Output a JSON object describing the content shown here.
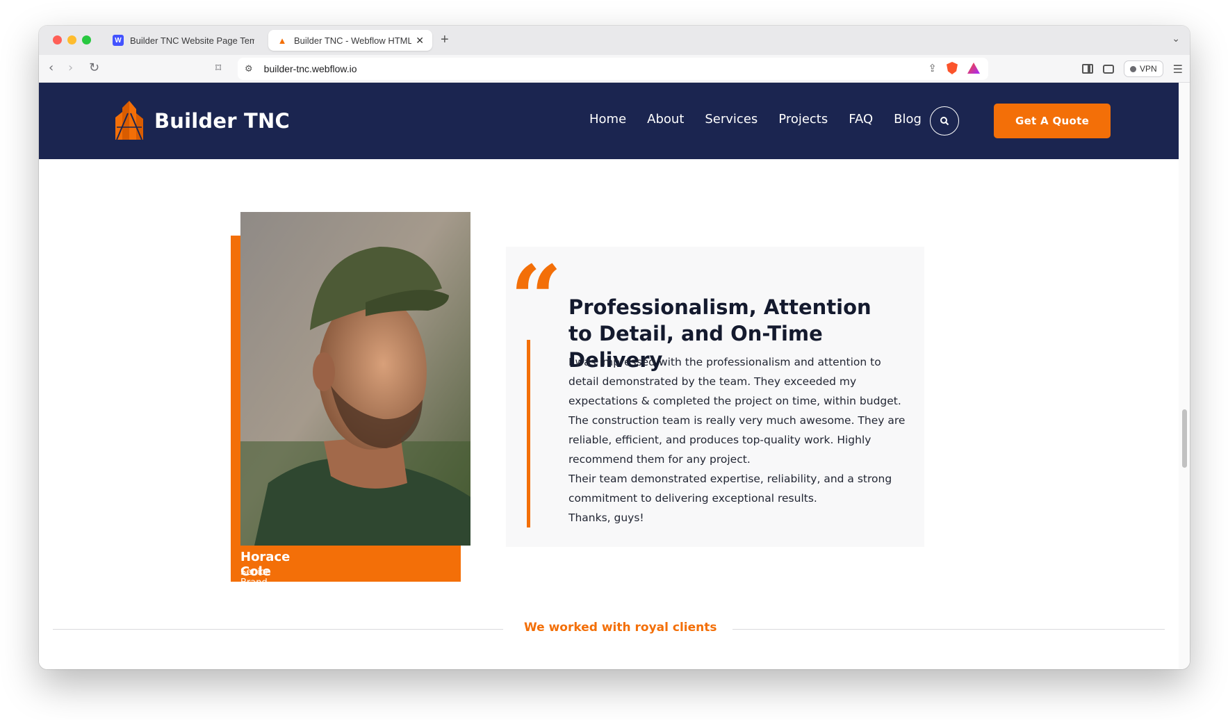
{
  "browser": {
    "tabs": [
      {
        "title": "Builder TNC Website Page Templ",
        "favicon": "webflow-icon",
        "active": false
      },
      {
        "title": "Builder TNC - Webflow HTML",
        "favicon": "builder-logo-icon",
        "active": true
      }
    ],
    "new_tab": "+",
    "url": "builder-tnc.webflow.io",
    "vpn_label": "VPN"
  },
  "site": {
    "brand": "Builder TNC",
    "nav": [
      "Home",
      "About",
      "Services",
      "Projects",
      "FAQ",
      "Blog"
    ],
    "cta": "Get A Quote",
    "accent_color": "#f36f08",
    "nav_bg": "#1b2550"
  },
  "testimonial": {
    "name": "Horace Cole",
    "role": "Senior Brand Specialist",
    "title": "Professionalism, Attention to Detail, and On-Time Delivery",
    "paragraphs": [
      "I was impressed with the professionalism and attention to detail demonstrated by the team. They exceeded my expectations & completed the project on time, within budget.",
      "The construction team is really very much awesome. They are reliable, efficient, and produces top-quality work. Highly recommend them for any project.",
      "Their team demonstrated expertise, reliability, and a strong commitment to delivering exceptional results.",
      "Thanks, guys!"
    ]
  },
  "clients": {
    "heading": "We worked with royal clients"
  }
}
